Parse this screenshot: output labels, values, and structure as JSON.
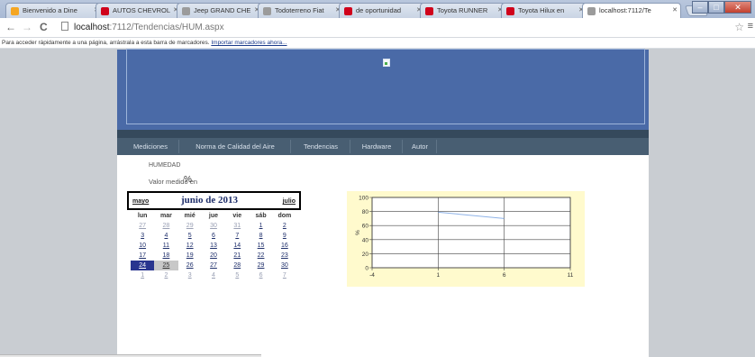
{
  "browser": {
    "tabs": [
      {
        "title": "Bienvenido a Dine",
        "icon_color": "#f5a623"
      },
      {
        "title": "AUTOS CHEVROL",
        "icon_color": "#d0021b"
      },
      {
        "title": "Jeep GRAND CHE",
        "icon_color": "#9b9b9b"
      },
      {
        "title": "Todoterreno Fiat",
        "icon_color": "#9b9b9b"
      },
      {
        "title": "de oportunidad",
        "icon_color": "#d0021b"
      },
      {
        "title": "Toyota RUNNER",
        "icon_color": "#d0021b"
      },
      {
        "title": "Toyota Hilux en",
        "icon_color": "#d0021b"
      },
      {
        "title": "localhost:7112/Te",
        "icon_color": "#9b9b9b"
      }
    ],
    "url_host": "localhost",
    "url_path": ":7112/Tendencias/HUM.aspx",
    "bookmarks_text": "Para acceder rápidamente a una página, arrástrala a esta barra de marcadores.",
    "bookmarks_link": "Importar marcadores ahora..."
  },
  "nav": {
    "items": [
      "Mediciones",
      "Norma de Calidad del Aire",
      "Tendencias",
      "Hardware",
      "Autor"
    ]
  },
  "content": {
    "title": "HUMEDAD",
    "valor_label": "Valor medido en",
    "unit": "%"
  },
  "calendar": {
    "prev": "mayo",
    "title": "junio de 2013",
    "next": "julio",
    "weekdays": [
      "lun",
      "mar",
      "mié",
      "jue",
      "vie",
      "sáb",
      "dom"
    ],
    "weeks": [
      [
        "27",
        "28",
        "29",
        "30",
        "31",
        "1",
        "2"
      ],
      [
        "3",
        "4",
        "5",
        "6",
        "7",
        "8",
        "9"
      ],
      [
        "10",
        "11",
        "12",
        "13",
        "14",
        "15",
        "16"
      ],
      [
        "17",
        "18",
        "19",
        "20",
        "21",
        "22",
        "23"
      ],
      [
        "24",
        "25",
        "26",
        "27",
        "28",
        "29",
        "30"
      ],
      [
        "1",
        "2",
        "3",
        "4",
        "5",
        "6",
        "7"
      ]
    ],
    "today": "24",
    "selected": "25"
  },
  "chart_data": {
    "type": "line",
    "title": "",
    "xlabel": "",
    "ylabel": "%",
    "xlim": [
      -4,
      11
    ],
    "ylim": [
      0,
      100
    ],
    "x_ticks": [
      "-4",
      "1",
      "6",
      "11"
    ],
    "y_ticks": [
      "0",
      "20",
      "40",
      "60",
      "80",
      "100"
    ],
    "series": [
      {
        "x": [
          1,
          6
        ],
        "values": [
          79,
          70
        ]
      }
    ],
    "colors": {
      "line": "#8fb3e8",
      "background": "#fffacd"
    }
  }
}
